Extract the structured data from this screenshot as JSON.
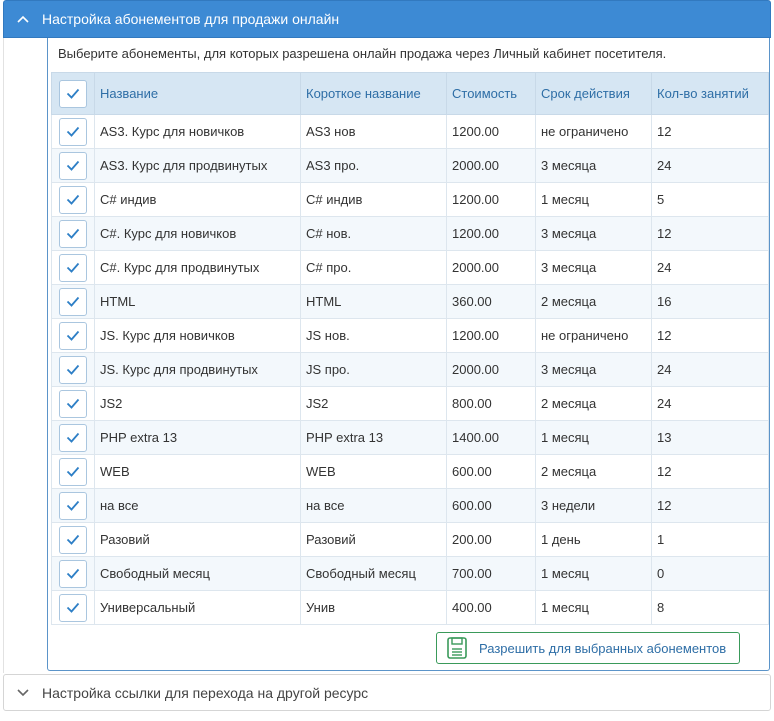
{
  "panel1": {
    "title": "Настройка абонементов для продажи онлайн",
    "description": "Выберите абонементы, для которых разрешена онлайн продажа через Личный кабинет посетителя."
  },
  "table": {
    "headers": [
      "Название",
      "Короткое название",
      "Стоимость",
      "Срок действия",
      "Кол-во занятий"
    ],
    "select_all_checked": true,
    "rows": [
      {
        "checked": true,
        "name": "AS3. Курс для новичков",
        "short": "AS3 нов",
        "price": "1200.00",
        "term": "не ограничено",
        "count": "12"
      },
      {
        "checked": true,
        "name": "AS3. Курс для продвинутых",
        "short": "AS3 про.",
        "price": "2000.00",
        "term": "3 месяца",
        "count": "24"
      },
      {
        "checked": true,
        "name": "C# индив",
        "short": "C# индив",
        "price": "1200.00",
        "term": "1 месяц",
        "count": "5"
      },
      {
        "checked": true,
        "name": "C#. Курс для новичков",
        "short": "C# нов.",
        "price": "1200.00",
        "term": "3 месяца",
        "count": "12"
      },
      {
        "checked": true,
        "name": "C#. Курс для продвинутых",
        "short": "C# про.",
        "price": "2000.00",
        "term": "3 месяца",
        "count": "24"
      },
      {
        "checked": true,
        "name": "HTML",
        "short": "HTML",
        "price": "360.00",
        "term": "2 месяца",
        "count": "16"
      },
      {
        "checked": true,
        "name": "JS. Курс для новичков",
        "short": "JS нов.",
        "price": "1200.00",
        "term": "не ограничено",
        "count": "12"
      },
      {
        "checked": true,
        "name": "JS. Курс для продвинутых",
        "short": "JS про.",
        "price": "2000.00",
        "term": "3 месяца",
        "count": "24"
      },
      {
        "checked": true,
        "name": "JS2",
        "short": "JS2",
        "price": "800.00",
        "term": "2 месяца",
        "count": "24"
      },
      {
        "checked": true,
        "name": "PHP extra 13",
        "short": "PHP extra 13",
        "price": "1400.00",
        "term": "1 месяц",
        "count": "13"
      },
      {
        "checked": true,
        "name": "WEB",
        "short": "WEB",
        "price": "600.00",
        "term": "2 месяца",
        "count": "12"
      },
      {
        "checked": true,
        "name": "на все",
        "short": "на все",
        "price": "600.00",
        "term": "3 недели",
        "count": "12"
      },
      {
        "checked": true,
        "name": "Разовий",
        "short": "Разовий",
        "price": "200.00",
        "term": "1 день",
        "count": "1"
      },
      {
        "checked": true,
        "name": "Свободный месяц",
        "short": "Свободный месяц",
        "price": "700.00",
        "term": "1 месяц",
        "count": "0"
      },
      {
        "checked": true,
        "name": "Универсальный",
        "short": "Унив",
        "price": "400.00",
        "term": "1 месяц",
        "count": "8"
      }
    ]
  },
  "save_button": {
    "label": "Разрешить для выбранных абонементов",
    "icon": "floppy-disk-icon"
  },
  "panel2": {
    "title": "Настройка ссылки для перехода на другой ресурс"
  },
  "colors": {
    "header_bg": "#3d8ad4",
    "accent": "#2e6ea6",
    "check": "#2e7fc6",
    "button_border": "#3a9a5a"
  }
}
